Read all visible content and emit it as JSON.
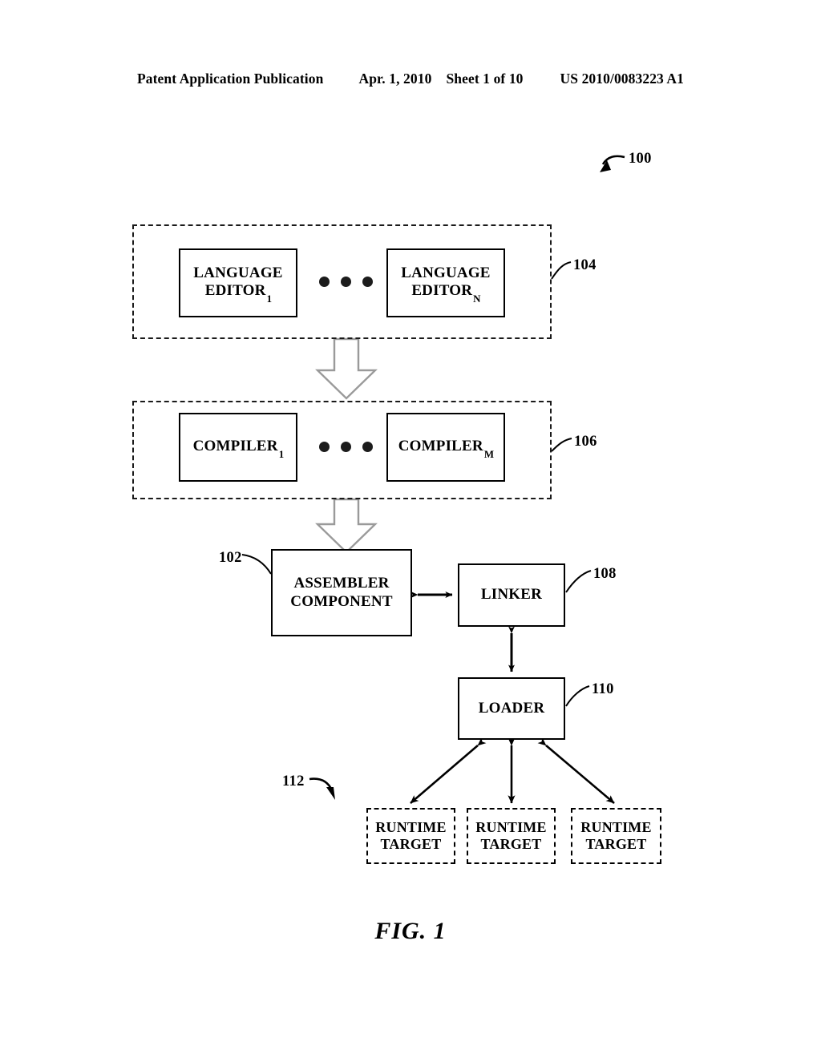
{
  "header": {
    "publication": "Patent Application Publication",
    "date": "Apr. 1, 2010",
    "sheet": "Sheet 1 of 10",
    "patent_number": "US 2010/0083223 A1"
  },
  "figure": {
    "caption": "FIG. 1",
    "system_ref": "100",
    "groups": {
      "editors": {
        "ref": "104"
      },
      "compilers": {
        "ref": "106"
      },
      "runtime_targets": {
        "ref": "112"
      }
    },
    "nodes": {
      "language_editor_1": {
        "line1": "LANGUAGE",
        "line2": "EDITOR",
        "subscript": "1"
      },
      "language_editor_n": {
        "line1": "LANGUAGE",
        "line2": "EDITOR",
        "subscript": "N"
      },
      "compiler_1": {
        "line1": "COMPILER",
        "subscript": "1"
      },
      "compiler_m": {
        "line1": "COMPILER",
        "subscript": "M"
      },
      "assembler": {
        "line1": "ASSEMBLER",
        "line2": "COMPONENT",
        "ref": "102"
      },
      "linker": {
        "line1": "LINKER",
        "ref": "108"
      },
      "loader": {
        "line1": "LOADER",
        "ref": "110"
      },
      "runtime_target_1": {
        "line1": "RUNTIME",
        "line2": "TARGET"
      },
      "runtime_target_2": {
        "line1": "RUNTIME",
        "line2": "TARGET"
      },
      "runtime_target_3": {
        "line1": "RUNTIME",
        "line2": "TARGET"
      }
    },
    "colors": {
      "ink": "#000000",
      "paper": "#ffffff",
      "block_arrow_outline": "#9a9a9a"
    }
  }
}
